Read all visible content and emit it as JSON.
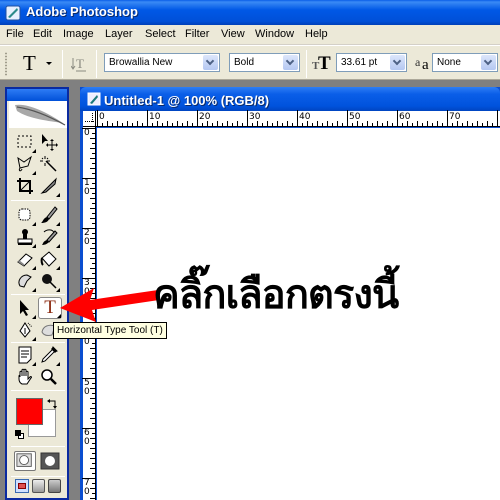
{
  "window": {
    "title": "Adobe Photoshop",
    "icon": "photoshop-icon"
  },
  "menu": [
    "File",
    "Edit",
    "Image",
    "Layer",
    "Select",
    "Filter",
    "View",
    "Window",
    "Help"
  ],
  "options_bar": {
    "tool_preset_icon": "type-tool-icon",
    "orientation_icon": "text-orientation-icon",
    "font_family": "Browallia New",
    "font_style": "Bold",
    "font_size_icon": "font-size-icon",
    "font_size": "33.61 pt",
    "antialias_icon": "antialias-icon",
    "antialias": "None"
  },
  "toolbox": {
    "tools": [
      {
        "name": "marquee-tool",
        "icon": "marquee-icon"
      },
      {
        "name": "move-tool",
        "icon": "move-icon"
      },
      {
        "name": "lasso-tool",
        "icon": "lasso-icon"
      },
      {
        "name": "magic-wand-tool",
        "icon": "magic-wand-icon"
      },
      {
        "name": "crop-tool",
        "icon": "crop-icon"
      },
      {
        "name": "slice-tool",
        "icon": "slice-icon"
      },
      {
        "name": "healing-brush-tool",
        "icon": "healing-icon"
      },
      {
        "name": "brush-tool",
        "icon": "brush-icon"
      },
      {
        "name": "clone-stamp-tool",
        "icon": "stamp-icon"
      },
      {
        "name": "history-brush-tool",
        "icon": "history-brush-icon"
      },
      {
        "name": "eraser-tool",
        "icon": "eraser-icon"
      },
      {
        "name": "paint-bucket-tool",
        "icon": "bucket-icon"
      },
      {
        "name": "smudge-tool",
        "icon": "smudge-icon"
      },
      {
        "name": "burn-tool",
        "icon": "burn-icon"
      },
      {
        "name": "path-selection-tool",
        "icon": "arrow-icon"
      },
      {
        "name": "type-tool",
        "icon": "type-icon",
        "selected": true
      },
      {
        "name": "pen-tool",
        "icon": "pen-icon"
      },
      {
        "name": "shape-tool",
        "icon": "shape-icon"
      },
      {
        "name": "notes-tool",
        "icon": "notes-icon"
      },
      {
        "name": "eyedropper-tool",
        "icon": "eyedropper-icon"
      },
      {
        "name": "hand-tool",
        "icon": "hand-icon"
      },
      {
        "name": "zoom-tool",
        "icon": "zoom-icon"
      }
    ],
    "foreground_color": "#ff0000",
    "background_color": "#ffffff"
  },
  "tooltip": "Horizontal Type Tool (T)",
  "document": {
    "title": "Untitled-1 @ 100% (RGB/8)",
    "h_ruler_labels": [
      "0",
      "10",
      "20",
      "30",
      "40",
      "50",
      "60",
      "70"
    ],
    "v_ruler_labels": [
      "0",
      "10",
      "20",
      "30",
      "40",
      "50",
      "60",
      "70"
    ]
  },
  "annotation": {
    "text": "คลิ๊กเลือกตรงนี้",
    "arrow_color": "#ff0000"
  }
}
